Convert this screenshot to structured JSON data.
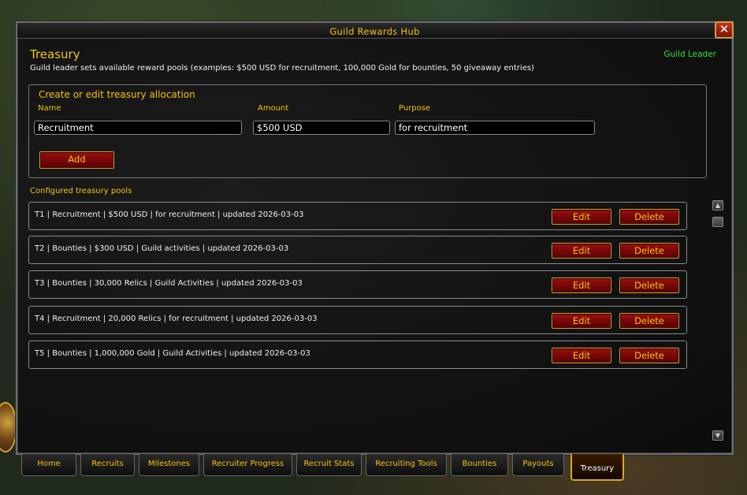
{
  "window": {
    "title": "Guild Rewards Hub",
    "close_symbol": "✕"
  },
  "header": {
    "section_title": "Treasury",
    "role": "Guild Leader",
    "description": "Guild leader sets available reward pools (examples: $500 USD for recruitment, 100,000 Gold for bounties, 50 giveaway entries)"
  },
  "form": {
    "title": "Create or edit treasury allocation",
    "name_label": "Name",
    "amount_label": "Amount",
    "purpose_label": "Purpose",
    "name_value": "Recruitment",
    "amount_value": "$500 USD",
    "purpose_value": "for recruitment",
    "add_label": "Add"
  },
  "pools": {
    "label": "Configured treasury pools",
    "edit_label": "Edit",
    "delete_label": "Delete",
    "items": [
      "T1 | Recruitment | $500 USD | for recruitment | updated 2026-03-03",
      "T2 | Bounties | $300 USD | Guild activities | updated 2026-03-03",
      "T3 | Bounties | 30,000 Relics | Guild Activities | updated 2026-03-03",
      "T4 | Recruitment | 20,000 Relics | for recruitment | updated 2026-03-03",
      "T5 | Bounties | 1,000,000 Gold | Guild Activities | updated 2026-03-03"
    ]
  },
  "scrollbar": {
    "up_symbol": "▲",
    "down_symbol": "▼"
  },
  "tabs": [
    "Home",
    "Recruits",
    "Milestones",
    "Recruiter Progress",
    "Recruit Stats",
    "Recruiting Tools",
    "Bounties",
    "Payouts",
    "Treasury"
  ],
  "active_tab": "Treasury",
  "colors": {
    "accent_gold": "#f2c40f",
    "role_green": "#33e033",
    "button_red": "#9a1010"
  }
}
